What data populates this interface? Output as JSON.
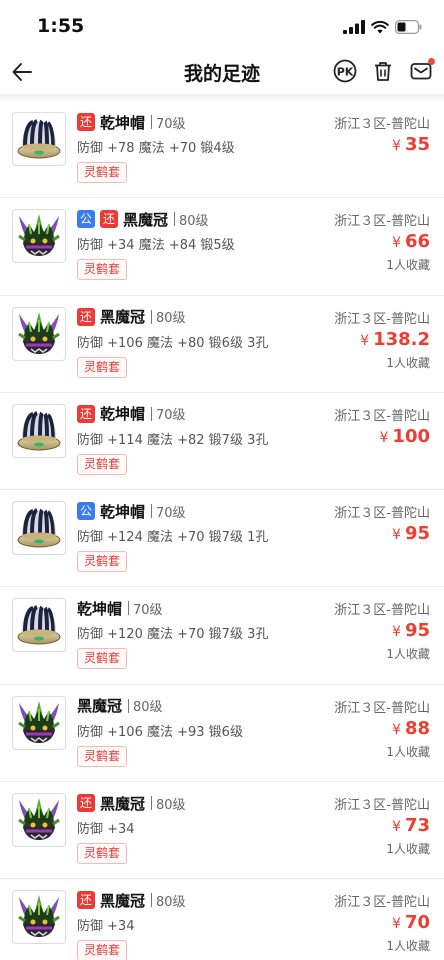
{
  "status_bar": {
    "time": "1:55"
  },
  "nav": {
    "title": "我的足迹",
    "icons": [
      "back-arrow-icon",
      "pk-icon",
      "trash-icon",
      "message-icon"
    ]
  },
  "badge_text": "灵鹤套",
  "colors": {
    "price": "#ef3d32",
    "tag_public": "#3b7bf2",
    "tag_return": "#ee3a34",
    "badge_border": "#f7b9b6"
  },
  "items": [
    {
      "image": "hat",
      "tags": [
        {
          "label": "还",
          "kind": "ret"
        }
      ],
      "name": "乾坤帽",
      "level": "70级",
      "stats": "防御 +78 魔法 +70  锻4级",
      "server": "浙江３区-普陀山",
      "price": "35",
      "favs": ""
    },
    {
      "image": "crown",
      "tags": [
        {
          "label": "公",
          "kind": "pub"
        },
        {
          "label": "还",
          "kind": "ret"
        }
      ],
      "name": "黑魔冠",
      "level": "80级",
      "stats": "防御 +34 魔法 +84  锻5级",
      "server": "浙江３区-普陀山",
      "price": "66",
      "favs": "1人收藏"
    },
    {
      "image": "crown",
      "tags": [
        {
          "label": "还",
          "kind": "ret"
        }
      ],
      "name": "黑魔冠",
      "level": "80级",
      "stats": "防御 +106 魔法 +80  锻6级  3孔",
      "server": "浙江３区-普陀山",
      "price": "138.2",
      "favs": "1人收藏"
    },
    {
      "image": "hat",
      "tags": [
        {
          "label": "还",
          "kind": "ret"
        }
      ],
      "name": "乾坤帽",
      "level": "70级",
      "stats": "防御 +114 魔法 +82  锻7级  3孔",
      "server": "浙江３区-普陀山",
      "price": "100",
      "favs": ""
    },
    {
      "image": "hat",
      "tags": [
        {
          "label": "公",
          "kind": "pub"
        }
      ],
      "name": "乾坤帽",
      "level": "70级",
      "stats": "防御 +124 魔法 +70  锻7级  1孔",
      "server": "浙江３区-普陀山",
      "price": "95",
      "favs": ""
    },
    {
      "image": "hat",
      "tags": [],
      "name": "乾坤帽",
      "level": "70级",
      "stats": "防御 +120 魔法 +70  锻7级  3孔",
      "server": "浙江３区-普陀山",
      "price": "95",
      "favs": "1人收藏"
    },
    {
      "image": "crown",
      "tags": [],
      "name": "黑魔冠",
      "level": "80级",
      "stats": "防御 +106 魔法 +93  锻6级",
      "server": "浙江３区-普陀山",
      "price": "88",
      "favs": "1人收藏"
    },
    {
      "image": "crown",
      "tags": [
        {
          "label": "还",
          "kind": "ret"
        }
      ],
      "name": "黑魔冠",
      "level": "80级",
      "stats": "防御 +34",
      "server": "浙江３区-普陀山",
      "price": "73",
      "favs": "1人收藏"
    },
    {
      "image": "crown",
      "tags": [
        {
          "label": "还",
          "kind": "ret"
        }
      ],
      "name": "黑魔冠",
      "level": "80级",
      "stats": "防御 +34",
      "server": "浙江３区-普陀山",
      "price": "70",
      "favs": "1人收藏"
    }
  ]
}
